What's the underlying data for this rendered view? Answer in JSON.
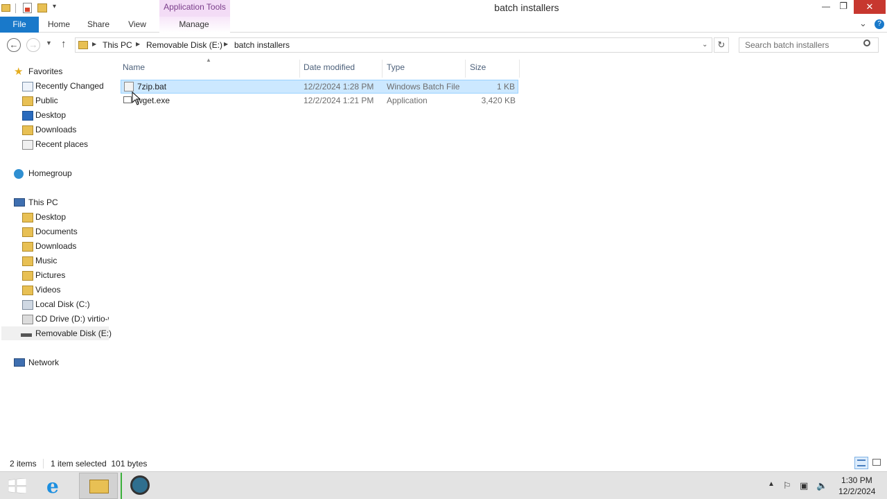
{
  "window": {
    "title": "batch installers",
    "context_tab": "Application Tools",
    "controls": {
      "minimize": "—",
      "restore": "❐",
      "close": "✕"
    }
  },
  "ribbon": {
    "tabs": [
      "File",
      "Home",
      "Share",
      "View",
      "Manage"
    ],
    "expand_icon": "⌄",
    "help_icon": "?"
  },
  "address": {
    "crumbs": [
      "This PC",
      "Removable Disk (E:)",
      "batch installers"
    ],
    "search_placeholder": "Search batch installers"
  },
  "nav": {
    "favorites_label": "Favorites",
    "favorites": [
      "Recently Changed",
      "Public",
      "Desktop",
      "Downloads",
      "Recent places"
    ],
    "homegroup_label": "Homegroup",
    "thispc_label": "This PC",
    "thispc": [
      "Desktop",
      "Documents",
      "Downloads",
      "Music",
      "Pictures",
      "Videos",
      "Local Disk (C:)",
      "CD Drive (D:) virtio-w",
      "Removable Disk (E:)"
    ],
    "network_label": "Network"
  },
  "columns": {
    "name": "Name",
    "date": "Date modified",
    "type": "Type",
    "size": "Size"
  },
  "files": [
    {
      "name": "7zip.bat",
      "date": "12/2/2024 1:28 PM",
      "type": "Windows Batch File",
      "size": "1 KB"
    },
    {
      "name": "wget.exe",
      "date": "12/2/2024 1:21 PM",
      "type": "Application",
      "size": "3,420 KB"
    }
  ],
  "status": {
    "items": "2 items",
    "selected": "1 item selected  101 bytes"
  },
  "taskbar": {
    "time": "1:30 PM",
    "date": "12/2/2024"
  },
  "colors": {
    "accent": "#1979ca",
    "selection": "#cce8ff",
    "context_tab": "#f3dcf6"
  }
}
